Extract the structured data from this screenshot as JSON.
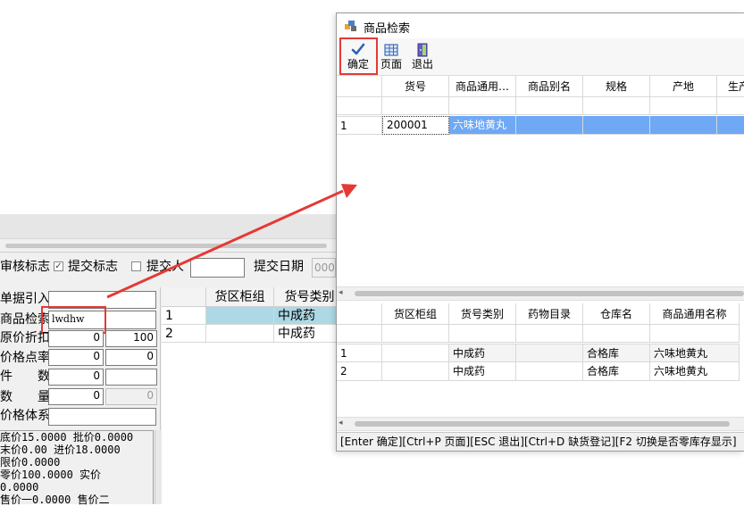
{
  "background_form": {
    "flags": {
      "audit_label": "审核标志",
      "submit_label": "提交标志",
      "submit_checked": true,
      "submitter_label": "提交人",
      "submit_date_label": "提交日期",
      "submit_date_value": "000"
    },
    "fields": {
      "doc_import_label": "单据引入",
      "search_label": "商品检索",
      "search_value": "lwdhw",
      "orig_discount_label": "原价折扣",
      "orig_discount_value": "0",
      "orig_discount_value2": "100",
      "price_markup_label": "价格点率",
      "price_markup_value": "0",
      "price_markup_value2": "0",
      "pieces_label": "件　　数",
      "pieces_value": "0",
      "quantity_label": "数　　量",
      "quantity_value": "0",
      "quantity_value2": "0",
      "price_system_label": "价格体系"
    },
    "info_lines": [
      "底价15.0000 批价0.0000",
      "末价0.00 进价18.0000",
      "限价0.0000",
      "零价100.0000 实价",
      "0.0000",
      "售价一0.0000 售价二"
    ],
    "grid": {
      "columns": [
        "",
        "货区柜组",
        "货号类别"
      ],
      "rows": [
        {
          "num": "1",
          "area": "",
          "category": "中成药"
        },
        {
          "num": "2",
          "area": "",
          "category": "中成药"
        }
      ]
    }
  },
  "dialog": {
    "title": "商品检索",
    "toolbar": {
      "confirm_label": "确定",
      "page_label": "页面",
      "exit_label": "退出"
    },
    "top_grid": {
      "columns": [
        "",
        "货号",
        "商品通用…",
        "商品别名",
        "规格",
        "产地",
        "生产"
      ],
      "rows": [
        {
          "num": "1",
          "code": "200001",
          "name": "六味地黄丸",
          "alias": "",
          "spec": "",
          "origin": "",
          "maker": ""
        }
      ]
    },
    "bottom_grid": {
      "columns": [
        "",
        "货区柜组",
        "货号类别",
        "药物目录",
        "仓库名",
        "商品通用名称"
      ],
      "rows": [
        {
          "num": "1",
          "area": "",
          "category": "中成药",
          "catalog": "",
          "warehouse": "合格库",
          "name": "六味地黄丸"
        },
        {
          "num": "2",
          "area": "",
          "category": "中成药",
          "catalog": "",
          "warehouse": "合格库",
          "name": "六味地黄丸"
        }
      ]
    },
    "status_text": "[Enter 确定][Ctrl+P 页面][ESC 退出][Ctrl+D 缺货登记][F2 切换是否零库存显示]"
  },
  "colors": {
    "selection": "#6fa8f5",
    "bg_selection": "#add8e6",
    "highlight_box": "#e53935",
    "arrow": "#e53935"
  }
}
